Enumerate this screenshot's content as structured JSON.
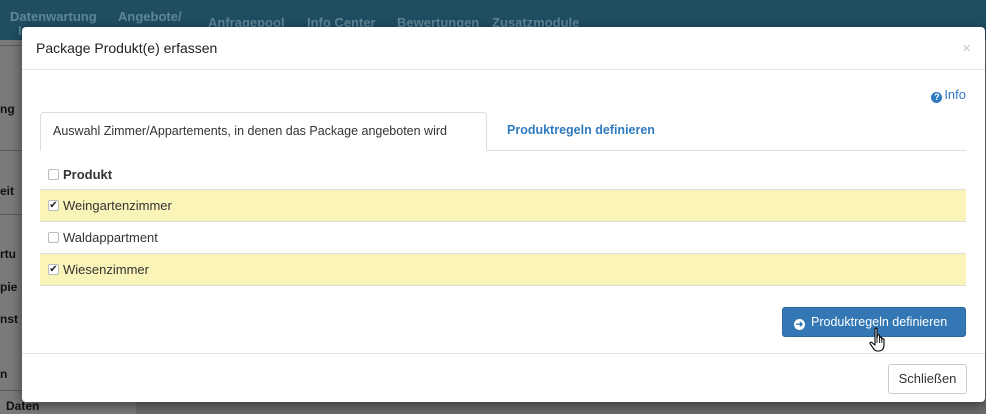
{
  "background": {
    "nav_items": [
      "Datenwartung",
      "Angebote/",
      "Anfragepool",
      "Info Center",
      "Bewertungen",
      "Zusatzmodule"
    ],
    "nav_subtext": "In",
    "sidebar_items": [
      "ng",
      "eit",
      "rtu",
      "pie",
      "nst",
      "n",
      "Daten"
    ]
  },
  "modal": {
    "title": "Package Produkt(e) erfassen",
    "close_symbol": "×",
    "info_label": "Info",
    "tabs": [
      {
        "label": "Auswahl Zimmer/Appartements, in denen das Package angeboten wird",
        "active": true
      },
      {
        "label": "Produktregeln definieren",
        "active": false
      }
    ],
    "table": {
      "header": "Produkt",
      "rows": [
        {
          "label": "Weingartenzimmer",
          "checked": true
        },
        {
          "label": "Waldappartment",
          "checked": false
        },
        {
          "label": "Wiesenzimmer",
          "checked": true
        }
      ]
    },
    "primary_button": "Produktregeln definieren",
    "close_button": "Schließen"
  },
  "colors": {
    "accent": "#3377b5",
    "link": "#2f7bbf",
    "selected_row": "#fbf4b8",
    "nav_bg": "#1f4e63"
  }
}
